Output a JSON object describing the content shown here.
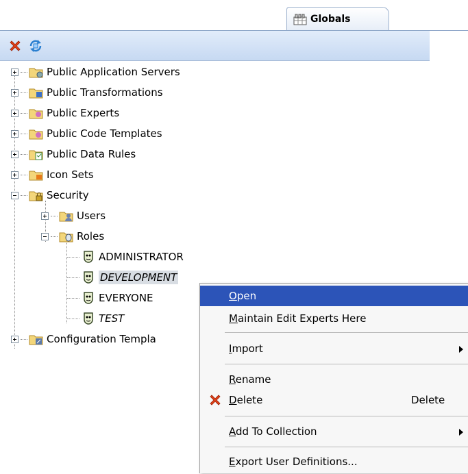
{
  "tab": {
    "label": "Globals"
  },
  "tree": {
    "nodes": [
      {
        "label": "Public Application Servers"
      },
      {
        "label": "Public Transformations"
      },
      {
        "label": "Public Experts"
      },
      {
        "label": "Public Code Templates"
      },
      {
        "label": "Public Data Rules"
      },
      {
        "label": "Icon Sets"
      },
      {
        "label": "Security"
      },
      {
        "label": "Users"
      },
      {
        "label": "Roles"
      },
      {
        "label": "ADMINISTRATOR"
      },
      {
        "label": "DEVELOPMENT"
      },
      {
        "label": "EVERYONE"
      },
      {
        "label": "TEST"
      },
      {
        "label": "Configuration Templa"
      }
    ]
  },
  "menu": {
    "open": {
      "mnemonic": "O",
      "rest": "pen"
    },
    "maintain": {
      "mnemonic": "M",
      "rest": "aintain Edit Experts Here"
    },
    "import": {
      "mnemonic": "I",
      "rest": "mport"
    },
    "rename": {
      "mnemonic": "R",
      "rest": "ename"
    },
    "delete": {
      "mnemonic": "D",
      "rest": "elete",
      "accelerator": "Delete"
    },
    "add_collection": {
      "mnemonic": "A",
      "rest": "dd To Collection"
    },
    "export": {
      "mnemonic": "E",
      "rest": "xport User Definitions..."
    }
  },
  "colors": {
    "highlight": "#2c54b8",
    "toolbar": "#c6d9f2",
    "delete_x": "#e0401a"
  },
  "icons": {
    "toolbar_delete": "red-x-icon",
    "toolbar_refresh": "refresh-icon",
    "role": "role-mask-icon"
  }
}
